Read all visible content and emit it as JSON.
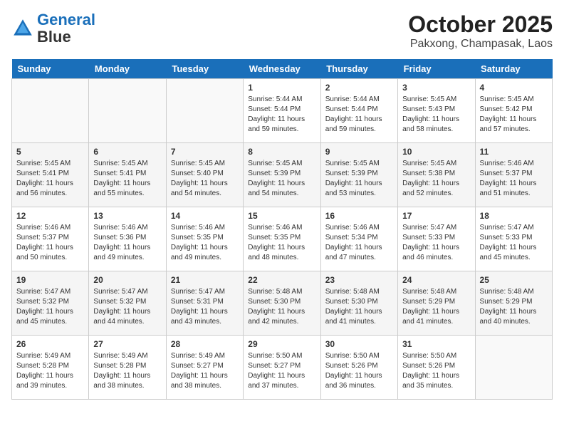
{
  "logo": {
    "line1": "General",
    "line2": "Blue"
  },
  "title": "October 2025",
  "subtitle": "Pakxong, Champasak, Laos",
  "days_of_week": [
    "Sunday",
    "Monday",
    "Tuesday",
    "Wednesday",
    "Thursday",
    "Friday",
    "Saturday"
  ],
  "weeks": [
    [
      {
        "day": "",
        "sunrise": "",
        "sunset": "",
        "daylight": ""
      },
      {
        "day": "",
        "sunrise": "",
        "sunset": "",
        "daylight": ""
      },
      {
        "day": "",
        "sunrise": "",
        "sunset": "",
        "daylight": ""
      },
      {
        "day": "1",
        "sunrise": "Sunrise: 5:44 AM",
        "sunset": "Sunset: 5:44 PM",
        "daylight": "Daylight: 11 hours and 59 minutes."
      },
      {
        "day": "2",
        "sunrise": "Sunrise: 5:44 AM",
        "sunset": "Sunset: 5:44 PM",
        "daylight": "Daylight: 11 hours and 59 minutes."
      },
      {
        "day": "3",
        "sunrise": "Sunrise: 5:45 AM",
        "sunset": "Sunset: 5:43 PM",
        "daylight": "Daylight: 11 hours and 58 minutes."
      },
      {
        "day": "4",
        "sunrise": "Sunrise: 5:45 AM",
        "sunset": "Sunset: 5:42 PM",
        "daylight": "Daylight: 11 hours and 57 minutes."
      }
    ],
    [
      {
        "day": "5",
        "sunrise": "Sunrise: 5:45 AM",
        "sunset": "Sunset: 5:41 PM",
        "daylight": "Daylight: 11 hours and 56 minutes."
      },
      {
        "day": "6",
        "sunrise": "Sunrise: 5:45 AM",
        "sunset": "Sunset: 5:41 PM",
        "daylight": "Daylight: 11 hours and 55 minutes."
      },
      {
        "day": "7",
        "sunrise": "Sunrise: 5:45 AM",
        "sunset": "Sunset: 5:40 PM",
        "daylight": "Daylight: 11 hours and 54 minutes."
      },
      {
        "day": "8",
        "sunrise": "Sunrise: 5:45 AM",
        "sunset": "Sunset: 5:39 PM",
        "daylight": "Daylight: 11 hours and 54 minutes."
      },
      {
        "day": "9",
        "sunrise": "Sunrise: 5:45 AM",
        "sunset": "Sunset: 5:39 PM",
        "daylight": "Daylight: 11 hours and 53 minutes."
      },
      {
        "day": "10",
        "sunrise": "Sunrise: 5:45 AM",
        "sunset": "Sunset: 5:38 PM",
        "daylight": "Daylight: 11 hours and 52 minutes."
      },
      {
        "day": "11",
        "sunrise": "Sunrise: 5:46 AM",
        "sunset": "Sunset: 5:37 PM",
        "daylight": "Daylight: 11 hours and 51 minutes."
      }
    ],
    [
      {
        "day": "12",
        "sunrise": "Sunrise: 5:46 AM",
        "sunset": "Sunset: 5:37 PM",
        "daylight": "Daylight: 11 hours and 50 minutes."
      },
      {
        "day": "13",
        "sunrise": "Sunrise: 5:46 AM",
        "sunset": "Sunset: 5:36 PM",
        "daylight": "Daylight: 11 hours and 49 minutes."
      },
      {
        "day": "14",
        "sunrise": "Sunrise: 5:46 AM",
        "sunset": "Sunset: 5:35 PM",
        "daylight": "Daylight: 11 hours and 49 minutes."
      },
      {
        "day": "15",
        "sunrise": "Sunrise: 5:46 AM",
        "sunset": "Sunset: 5:35 PM",
        "daylight": "Daylight: 11 hours and 48 minutes."
      },
      {
        "day": "16",
        "sunrise": "Sunrise: 5:46 AM",
        "sunset": "Sunset: 5:34 PM",
        "daylight": "Daylight: 11 hours and 47 minutes."
      },
      {
        "day": "17",
        "sunrise": "Sunrise: 5:47 AM",
        "sunset": "Sunset: 5:33 PM",
        "daylight": "Daylight: 11 hours and 46 minutes."
      },
      {
        "day": "18",
        "sunrise": "Sunrise: 5:47 AM",
        "sunset": "Sunset: 5:33 PM",
        "daylight": "Daylight: 11 hours and 45 minutes."
      }
    ],
    [
      {
        "day": "19",
        "sunrise": "Sunrise: 5:47 AM",
        "sunset": "Sunset: 5:32 PM",
        "daylight": "Daylight: 11 hours and 45 minutes."
      },
      {
        "day": "20",
        "sunrise": "Sunrise: 5:47 AM",
        "sunset": "Sunset: 5:32 PM",
        "daylight": "Daylight: 11 hours and 44 minutes."
      },
      {
        "day": "21",
        "sunrise": "Sunrise: 5:47 AM",
        "sunset": "Sunset: 5:31 PM",
        "daylight": "Daylight: 11 hours and 43 minutes."
      },
      {
        "day": "22",
        "sunrise": "Sunrise: 5:48 AM",
        "sunset": "Sunset: 5:30 PM",
        "daylight": "Daylight: 11 hours and 42 minutes."
      },
      {
        "day": "23",
        "sunrise": "Sunrise: 5:48 AM",
        "sunset": "Sunset: 5:30 PM",
        "daylight": "Daylight: 11 hours and 41 minutes."
      },
      {
        "day": "24",
        "sunrise": "Sunrise: 5:48 AM",
        "sunset": "Sunset: 5:29 PM",
        "daylight": "Daylight: 11 hours and 41 minutes."
      },
      {
        "day": "25",
        "sunrise": "Sunrise: 5:48 AM",
        "sunset": "Sunset: 5:29 PM",
        "daylight": "Daylight: 11 hours and 40 minutes."
      }
    ],
    [
      {
        "day": "26",
        "sunrise": "Sunrise: 5:49 AM",
        "sunset": "Sunset: 5:28 PM",
        "daylight": "Daylight: 11 hours and 39 minutes."
      },
      {
        "day": "27",
        "sunrise": "Sunrise: 5:49 AM",
        "sunset": "Sunset: 5:28 PM",
        "daylight": "Daylight: 11 hours and 38 minutes."
      },
      {
        "day": "28",
        "sunrise": "Sunrise: 5:49 AM",
        "sunset": "Sunset: 5:27 PM",
        "daylight": "Daylight: 11 hours and 38 minutes."
      },
      {
        "day": "29",
        "sunrise": "Sunrise: 5:50 AM",
        "sunset": "Sunset: 5:27 PM",
        "daylight": "Daylight: 11 hours and 37 minutes."
      },
      {
        "day": "30",
        "sunrise": "Sunrise: 5:50 AM",
        "sunset": "Sunset: 5:26 PM",
        "daylight": "Daylight: 11 hours and 36 minutes."
      },
      {
        "day": "31",
        "sunrise": "Sunrise: 5:50 AM",
        "sunset": "Sunset: 5:26 PM",
        "daylight": "Daylight: 11 hours and 35 minutes."
      },
      {
        "day": "",
        "sunrise": "",
        "sunset": "",
        "daylight": ""
      }
    ]
  ]
}
